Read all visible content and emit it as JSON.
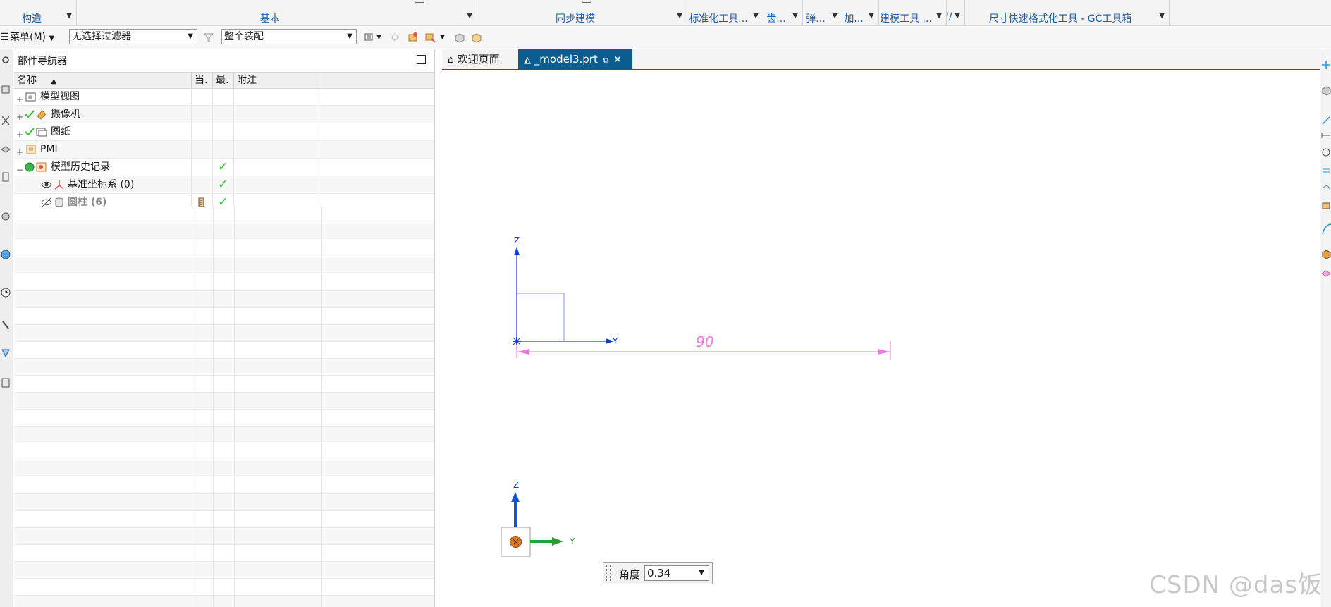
{
  "ribbon": {
    "groups": [
      {
        "label": "构造"
      },
      {
        "label": "基本"
      },
      {
        "label": "同步建模"
      },
      {
        "label": "标准化工具..."
      },
      {
        "label": "齿..."
      },
      {
        "label": "弹..."
      },
      {
        "label": "加..."
      },
      {
        "label": "建模工具 ..."
      },
      {
        "label": "'/."
      },
      {
        "label": "尺寸快速格式化工具 - GC工具箱"
      }
    ]
  },
  "toolbar": {
    "menu_label": "菜单(M)",
    "filter_value": "无选择过滤器",
    "scope_value": "整个装配"
  },
  "navigator": {
    "title": "部件导航器",
    "columns": {
      "name": "名称",
      "current": "当.",
      "latest": "最.",
      "note": "附注"
    },
    "rows": [
      {
        "label": "模型视图",
        "expander": "+",
        "latest_check": ""
      },
      {
        "label": "摄像机",
        "expander": "+",
        "latest_check": ""
      },
      {
        "label": "图纸",
        "expander": "+",
        "latest_check": ""
      },
      {
        "label": "PMI",
        "expander": "+",
        "latest_check": ""
      },
      {
        "label": "模型历史记录",
        "expander": "−",
        "latest_check": "✓"
      },
      {
        "label": "基准坐标系 (0)",
        "expander": "",
        "latest_check": "✓"
      },
      {
        "label": "圆柱 (6)",
        "expander": "",
        "latest_check": "✓"
      }
    ]
  },
  "tabs": {
    "welcome": "欢迎页面",
    "model": "_model3.prt"
  },
  "viewport": {
    "dimension_value": "90",
    "axis_z": "Z",
    "axis_y": "Y",
    "triad_z": "Z",
    "triad_y": "Y"
  },
  "angle_input": {
    "label": "角度",
    "value": "0.34"
  },
  "watermark": "CSDN @das饭",
  "colors": {
    "ribbon_text": "#1b5aa8",
    "active_tab": "#0b5d8f",
    "check": "#2ec52e",
    "dimension": "#f075e6",
    "sketch": "#8f8fff",
    "axis": "#1a3fd6",
    "triad_y": "#2f9a2f",
    "triad_z": "#1553d6"
  }
}
